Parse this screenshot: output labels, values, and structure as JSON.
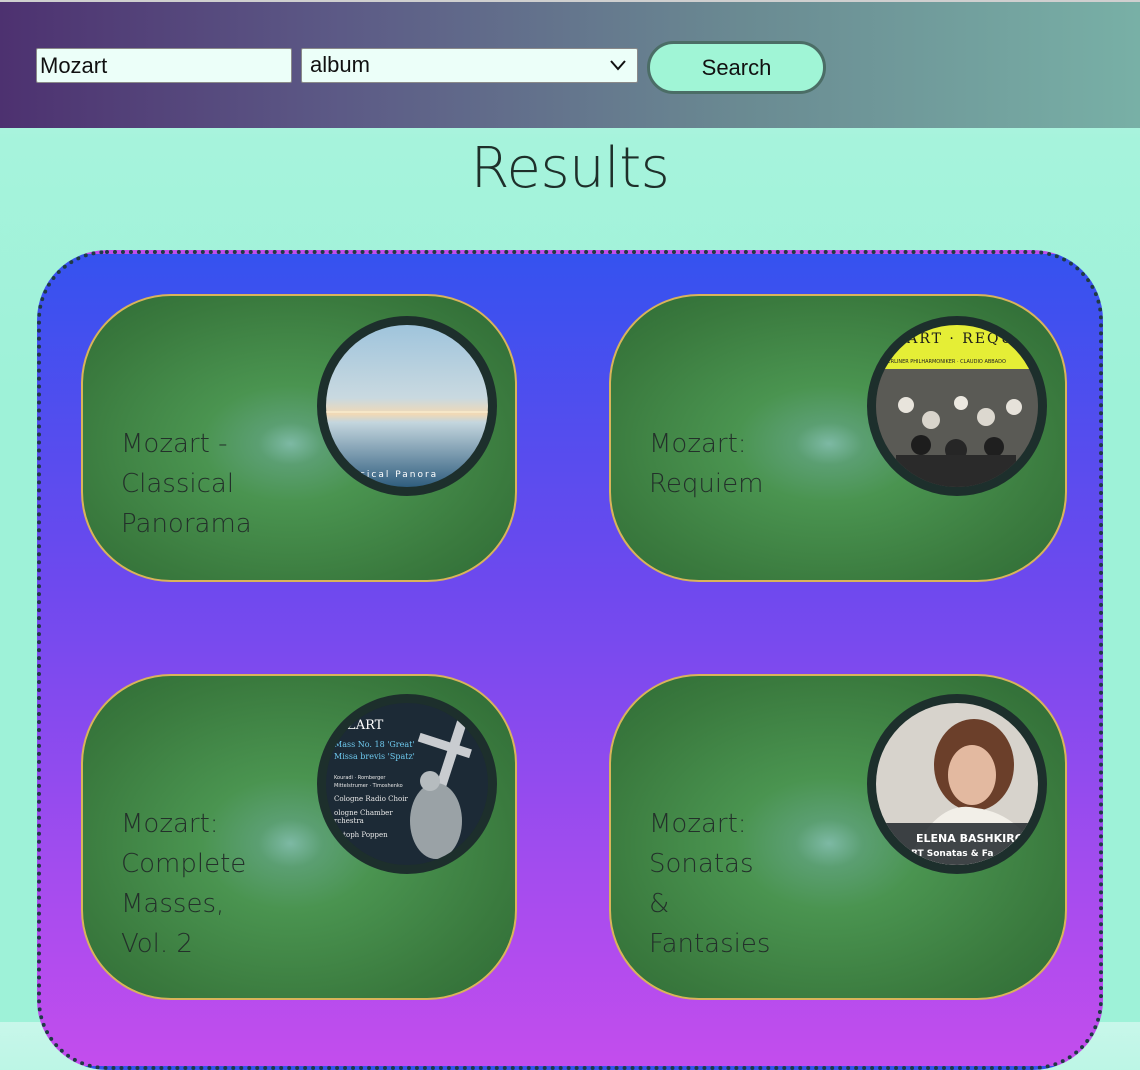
{
  "search": {
    "query": "Mozart",
    "type_selected": "album",
    "button_label": "Search"
  },
  "results_title": "Results",
  "results": [
    {
      "title": "Mozart -\nClassical\nPanorama",
      "art_text": "assical Panora"
    },
    {
      "title": "Mozart:\nRequiem",
      "art_text_top": "OZART · REQUIE",
      "art_text_mid": "BERLINER PHILHARMONIKER · CLAUDIO ABBADO"
    },
    {
      "title": "Mozart:\nComplete\nMasses,\nVol. 2",
      "art_lines": [
        "OZART",
        "Mass No. 18 'Great'",
        "Missa brevis 'Spatz'",
        "Kouradi · Romberger",
        "Mittelstrumer · Timoshenko",
        "Cologne Radio Choir",
        "ologne Chamber",
        "rchestra",
        "ristoph Poppen"
      ]
    },
    {
      "title": "Mozart:\nSonatas\n&\nFantasies",
      "art_name": "ELENA BASHKIRO",
      "art_sub": "ART Sonatas & Fa"
    }
  ],
  "colors": {
    "header_start": "#4d3170",
    "header_end": "#78b0a6",
    "page_bg": "#9ef2d8",
    "panel_top": "#3552ef",
    "panel_bottom": "#c34ded",
    "card_green": "#4a9450",
    "card_border": "#d9b45a",
    "button_bg": "#a0f5d6"
  }
}
